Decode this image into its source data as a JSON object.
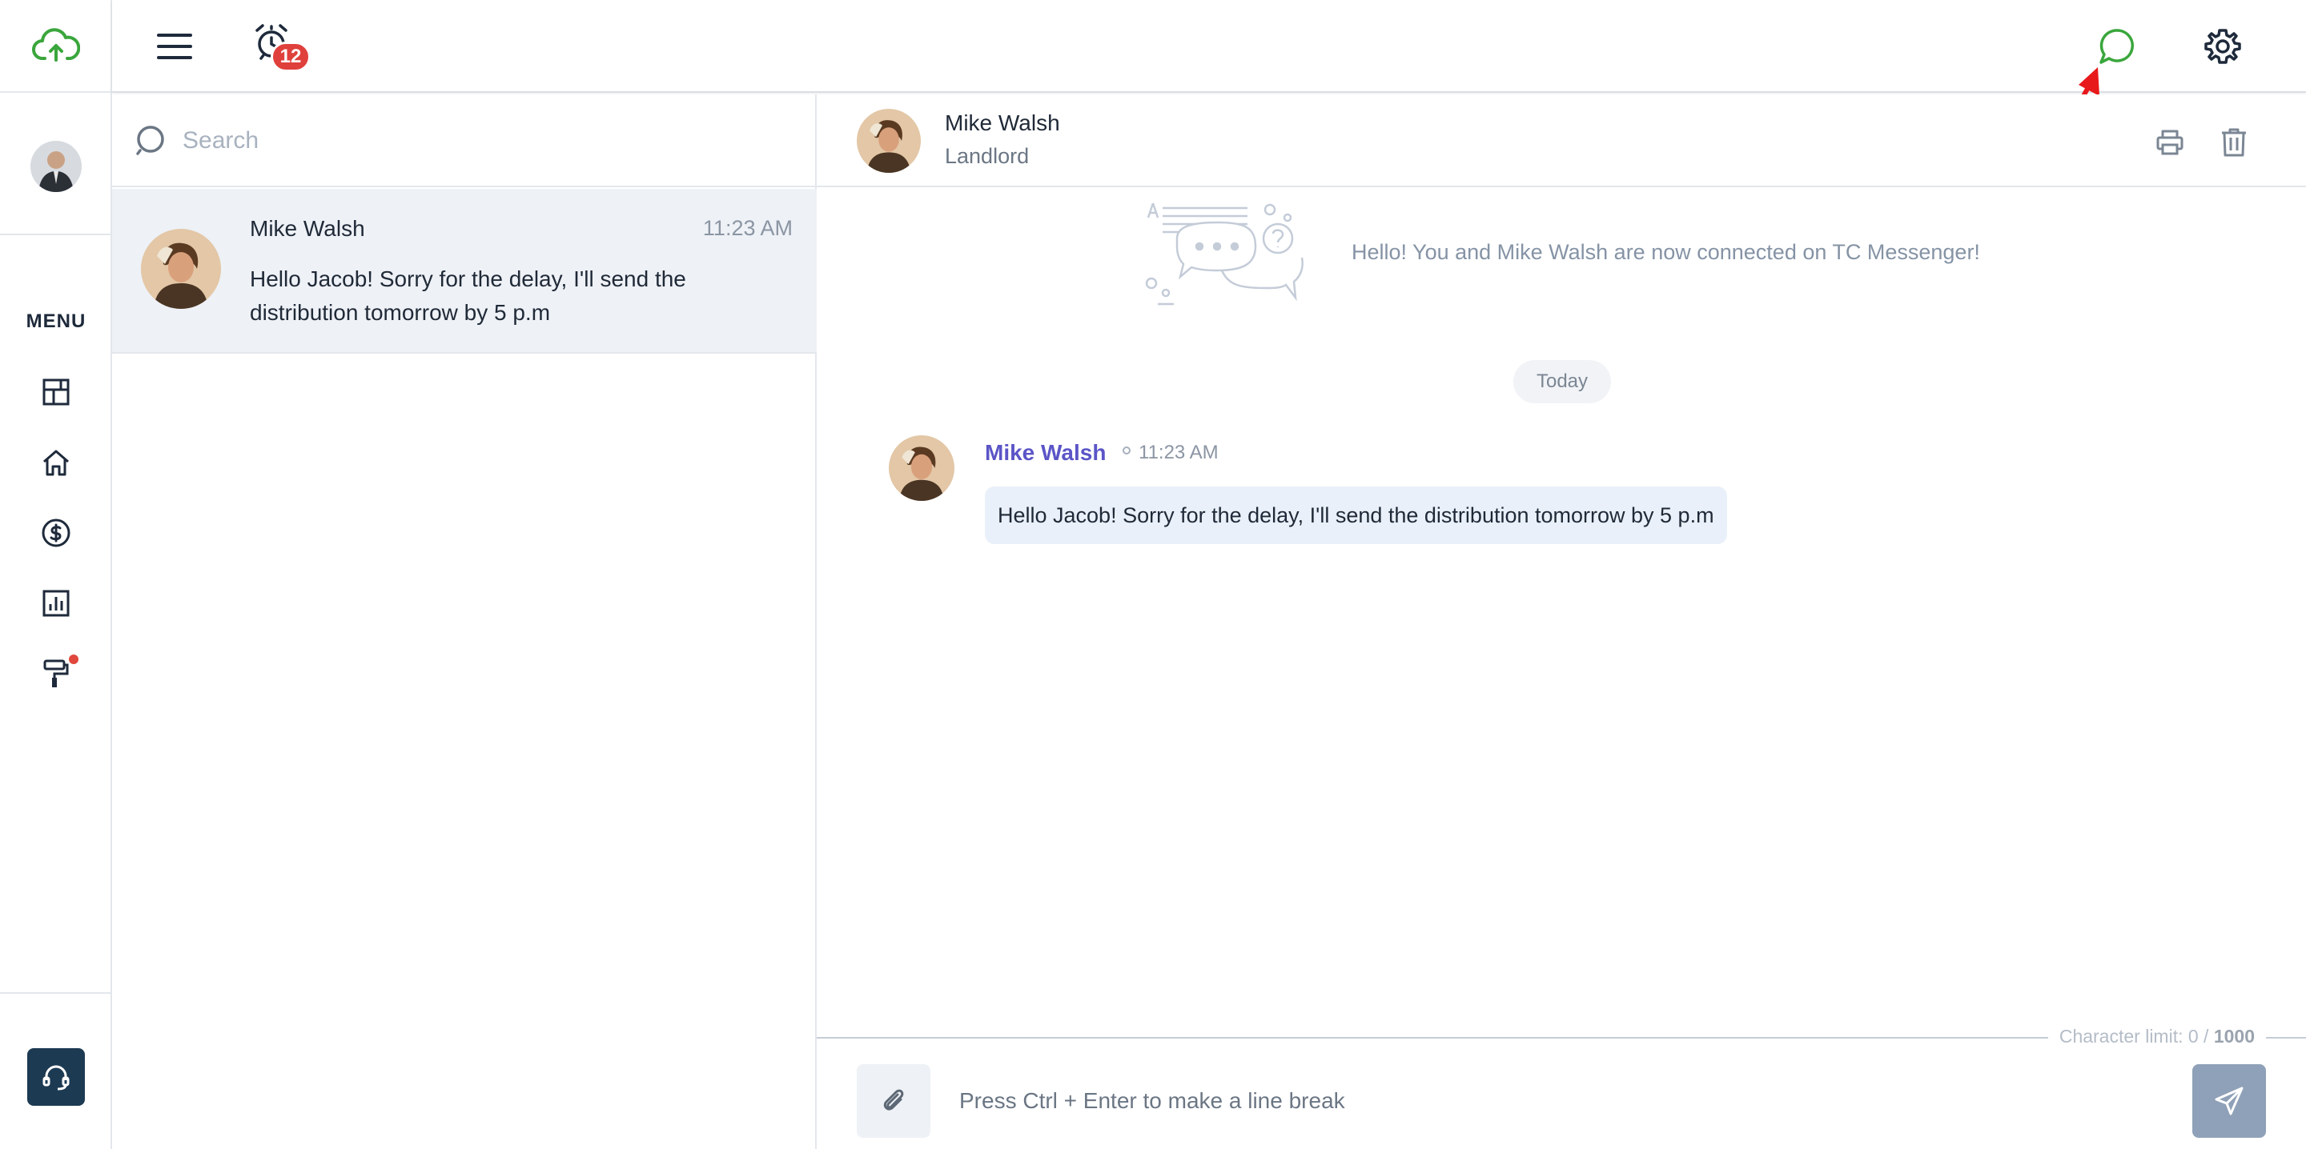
{
  "colors": {
    "brand_green": "#3aa63c",
    "badge_red": "#e0403b",
    "sender_purple": "#5b55c7",
    "active_row": "#eef1f6",
    "annotation_red": "#e8191b"
  },
  "rail": {
    "logo_icon": "cloud-upload-icon",
    "menu_label": "MENU",
    "nav_items": [
      {
        "name": "dashboard",
        "icon": "dashboard-icon"
      },
      {
        "name": "properties",
        "icon": "home-icon"
      },
      {
        "name": "accounting",
        "icon": "dollar-icon"
      },
      {
        "name": "reports",
        "icon": "bar-chart-icon"
      },
      {
        "name": "maintenance",
        "icon": "paint-roller-icon",
        "has_dot": true
      }
    ],
    "support_icon": "headset-icon"
  },
  "topbar": {
    "notification_count": "12",
    "chat_icon": "chat-bubble-icon",
    "settings_icon": "gear-icon"
  },
  "search": {
    "placeholder": "Search"
  },
  "conversations": [
    {
      "name": "Mike Walsh",
      "time": "11:23 AM",
      "preview": "Hello Jacob! Sorry for the delay, I'll send the distribution tomorrow by 5 p.m"
    }
  ],
  "chat": {
    "contact_name": "Mike Walsh",
    "contact_role": "Landlord",
    "connected_text": "Hello! You and Mike Walsh are now connected on TC Messenger!",
    "date_divider": "Today",
    "messages": [
      {
        "sender": "Mike Walsh",
        "time": "11:23 AM",
        "text": "Hello Jacob! Sorry for the delay, I'll send the distribution tomorrow by 5 p.m"
      }
    ],
    "char_limit_label": "Character limit: 0 / ",
    "char_limit_max": "1000",
    "compose_placeholder": "Press Ctrl + Enter to make a line break"
  }
}
